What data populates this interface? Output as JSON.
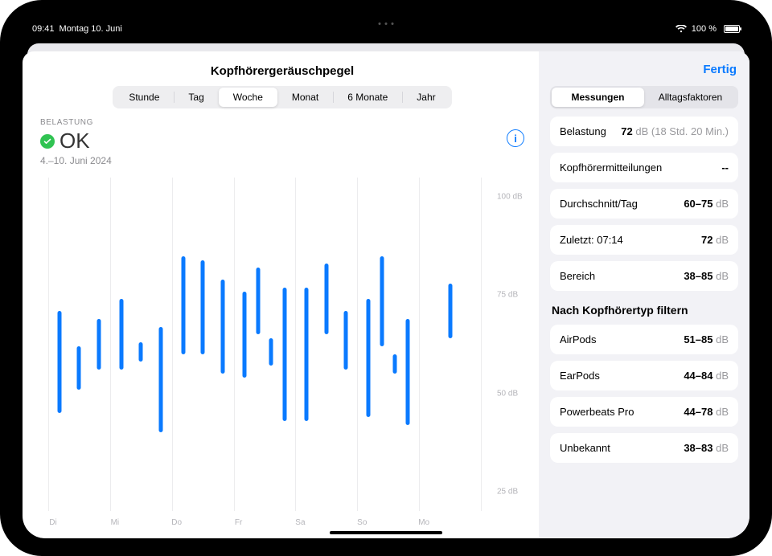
{
  "status": {
    "time": "09:41",
    "date": "Montag 10. Juni",
    "battery_pct": "100 %"
  },
  "header": {
    "title": "Kopfhörergeräuschpegel",
    "done": "Fertig"
  },
  "timescale": {
    "items": [
      "Stunde",
      "Tag",
      "Woche",
      "Monat",
      "6 Monate",
      "Jahr"
    ],
    "active_index": 2
  },
  "summary": {
    "exposure_label": "BELASTUNG",
    "status_text": "OK",
    "date_range": "4.–10. Juni 2024"
  },
  "side_tabs": {
    "items": [
      "Messungen",
      "Alltagsfaktoren"
    ],
    "active_index": 0
  },
  "metrics": [
    {
      "label": "Belastung",
      "value_main": "72",
      "unit": "dB",
      "value_sub": "(18 Std. 20 Min.)"
    },
    {
      "label": "Kopfhörermitteilungen",
      "value_main": "--",
      "unit": "",
      "value_sub": ""
    },
    {
      "label": "Durchschnitt/Tag",
      "value_main": "60–75",
      "unit": "dB",
      "value_sub": ""
    },
    {
      "label": "Zuletzt: 07:14",
      "value_main": "72",
      "unit": "dB",
      "value_sub": ""
    },
    {
      "label": "Bereich",
      "value_main": "38–85",
      "unit": "dB",
      "value_sub": ""
    }
  ],
  "filter_header": "Nach Kopfhörertyp filtern",
  "filters": [
    {
      "label": "AirPods",
      "value_main": "51–85",
      "unit": "dB"
    },
    {
      "label": "EarPods",
      "value_main": "44–84",
      "unit": "dB"
    },
    {
      "label": "Powerbeats Pro",
      "value_main": "44–78",
      "unit": "dB"
    },
    {
      "label": "Unbekannt",
      "value_main": "38–83",
      "unit": "dB"
    }
  ],
  "chart_data": {
    "type": "range-bar",
    "ylabel_unit": "dB",
    "ylim": [
      20,
      105
    ],
    "yticks": [
      25,
      50,
      75,
      100
    ],
    "ytick_labels": [
      "25 dB",
      "50 dB",
      "75 dB",
      "100 dB"
    ],
    "categories": [
      "Di",
      "Mi",
      "Do",
      "Fr",
      "Sa",
      "So",
      "Mo"
    ],
    "series": [
      {
        "day": "Di",
        "ranges": [
          [
            45,
            71
          ],
          [
            51,
            62
          ],
          [
            56,
            69
          ]
        ]
      },
      {
        "day": "Mi",
        "ranges": [
          [
            56,
            74
          ],
          [
            58,
            63
          ],
          [
            40,
            67
          ]
        ]
      },
      {
        "day": "Do",
        "ranges": [
          [
            60,
            85
          ],
          [
            60,
            84
          ],
          [
            55,
            79
          ]
        ]
      },
      {
        "day": "Fr",
        "ranges": [
          [
            54,
            76
          ],
          [
            65,
            82
          ],
          [
            57,
            64
          ],
          [
            43,
            77
          ]
        ]
      },
      {
        "day": "Sa",
        "ranges": [
          [
            43,
            77
          ],
          [
            65,
            83
          ],
          [
            56,
            71
          ]
        ]
      },
      {
        "day": "So",
        "ranges": [
          [
            44,
            74
          ],
          [
            62,
            85
          ],
          [
            55,
            60
          ],
          [
            42,
            69
          ]
        ]
      },
      {
        "day": "Mo",
        "ranges": [
          [
            64,
            78
          ]
        ]
      }
    ]
  }
}
